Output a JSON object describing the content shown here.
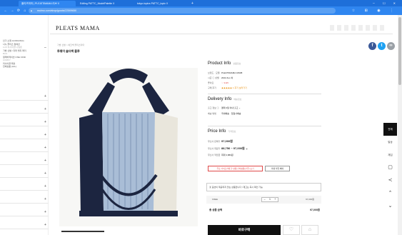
{
  "browser": {
    "tabs": [
      {
        "label": "플리츠마마 | PLEATSMAMA 러브 X"
      },
      {
        "label": "Editing PATTC_ModelPalette X"
      },
      {
        "label": "tokyo-topics PATTC_topic X"
      }
    ],
    "url": "mulmo.com/shop/goods/22509650",
    "nav": {
      "back": "←",
      "forward": "→",
      "reload": "⟳",
      "home": "⌂"
    }
  },
  "sidebar": {
    "categories": [
      {
        "label": "인기 소재 ACIDIA BAG",
        "sub": ""
      },
      {
        "label": "나누 플리츠 컬렉션",
        "sub": "LUX 리사이클 나일론"
      },
      {
        "label": "가방 신발 / 지퍼 엣지 레더",
        "sub": "BAG"
      },
      {
        "label": "컬래버레이션 ONE KIND",
        "sub": "COMFY"
      },
      {
        "label": "리사이클 패션",
        "sub": ""
      },
      {
        "label": "전체상품 (ALL)",
        "sub": ""
      }
    ]
  },
  "header": {
    "logo": "PLEATS MAMA"
  },
  "product": {
    "breadcrumb": "가방 신발 > 에코백 플리츠마마",
    "title": "투웨이 숄더백 블루"
  },
  "share": {
    "facebook": "f",
    "twitter": "t",
    "link": "∞"
  },
  "product_info": {
    "title": "Product Info",
    "subtitle": "상품정보",
    "rows": [
      {
        "label": "브랜드 · 모델",
        "value": "PLEATSMAMA 18498"
      },
      {
        "label": "시즌 ⓘ 성별",
        "value": "2022 ALL 여"
      },
      {
        "label": "좋아요",
        "value": "♡ 3115"
      },
      {
        "label": "구매 후기",
        "value": "★★★★★ 1  후기 보러가기"
      }
    ]
  },
  "delivery_info": {
    "title": "Delivery Info",
    "subtitle": "배송정보",
    "rows": [
      {
        "label": "출고 정보 ⓘ",
        "value": "결제 3일 이내 출고  ⌄"
      },
      {
        "label": "배송 방법",
        "value": "국내배송 · 입점사배송"
      }
    ]
  },
  "price_info": {
    "title": "Price Info",
    "subtitle": "가격정보",
    "rows": [
      {
        "label": "무신사 판매가",
        "value": "97,000원"
      },
      {
        "label": "무신사 회원가",
        "value": "88,756 ~ 97,000원  ⌄"
      },
      {
        "label": "무신사 적립금",
        "value": "최대 3,880원"
      }
    ],
    "coupon_button": "무료 사이즈카에 한 상품 전체상품(쿠폰) 보기",
    "benefit_button": "최대 적립 혜택"
  },
  "order": {
    "option_placeholder": "옵션이 제공되지 않는 상품입니다 / 재고는 즉시 확인 가능",
    "qty_label": "FREE",
    "qty_value": "1",
    "line_price": "97,000원",
    "total_label": "총 상품 금액",
    "total_value": "97,000원",
    "buy_label": "바로구매"
  },
  "float_menu": {
    "items": [
      {
        "label": "전체"
      },
      {
        "label": "발송"
      },
      {
        "label": "재입"
      }
    ]
  }
}
